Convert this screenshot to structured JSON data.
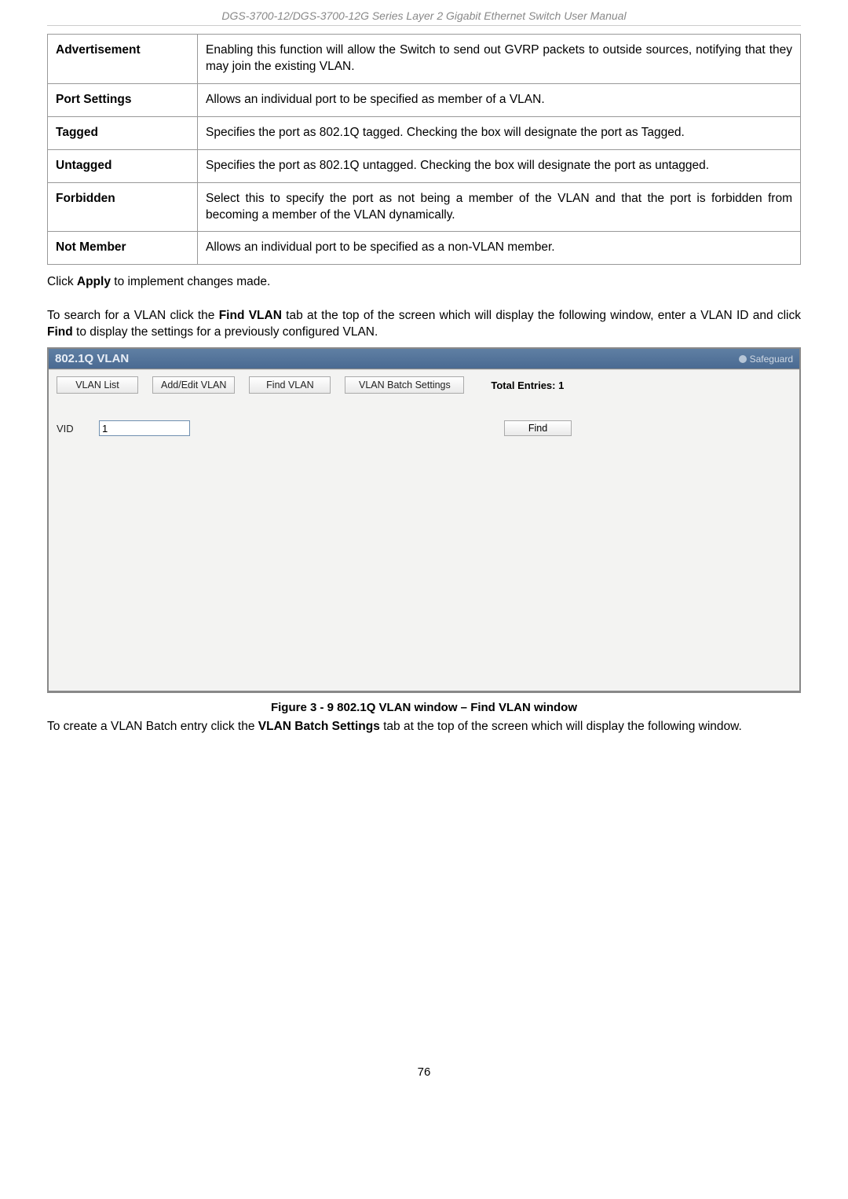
{
  "doc_header": "DGS-3700-12/DGS-3700-12G Series Layer 2 Gigabit Ethernet Switch User Manual",
  "table": {
    "rows": [
      {
        "key": "Advertisement",
        "desc": "Enabling this function will allow the Switch to send out GVRP packets to outside sources, notifying that they may join the existing VLAN."
      },
      {
        "key": "Port Settings",
        "desc": "Allows an individual port to be specified as member of a VLAN."
      },
      {
        "key": "Tagged",
        "desc": "Specifies the port as 802.1Q tagged. Checking the box will designate the port as Tagged."
      },
      {
        "key": "Untagged",
        "desc": "Specifies the port as 802.1Q untagged. Checking the box will designate the port as untagged."
      },
      {
        "key": "Forbidden",
        "desc": "Select this to specify the port as not being a member of the VLAN and that the port is forbidden from becoming a member of the VLAN dynamically."
      },
      {
        "key": "Not Member",
        "desc": "Allows an individual port to be specified as a non-VLAN member."
      }
    ]
  },
  "para1_pre": "Click ",
  "para1_bold": "Apply",
  "para1_post": " to implement changes made.",
  "para2_pre": "To search for a VLAN click the ",
  "para2_b1": "Find VLAN",
  "para2_mid": " tab at the top of the screen which will display the following window, enter a VLAN ID and click ",
  "para2_b2": "Find",
  "para2_post": " to display the settings for a previously configured VLAN.",
  "figure": {
    "title": "802.1Q VLAN",
    "safeguard": "Safeguard",
    "tabs": {
      "vlan_list": "VLAN List",
      "add_edit": "Add/Edit VLAN",
      "find_vlan": "Find VLAN",
      "batch": "VLAN Batch Settings"
    },
    "total_entries": "Total Entries: 1",
    "vid_label": "VID",
    "vid_value": "1",
    "find_btn": "Find"
  },
  "fig_caption": "Figure 3 - 9 802.1Q VLAN window – Find VLAN window",
  "para3_pre": "To create a VLAN Batch entry click the ",
  "para3_bold": "VLAN Batch Settings",
  "para3_post": " tab at the top of the screen which will display the following window.",
  "page_number": "76"
}
